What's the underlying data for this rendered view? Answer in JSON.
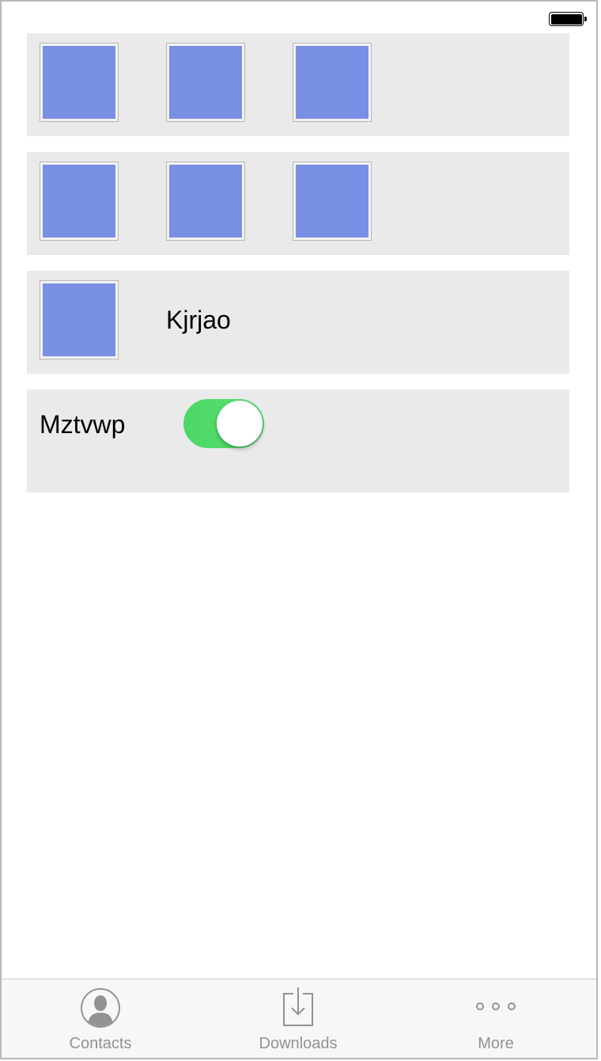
{
  "status_bar": {
    "battery_icon": "battery-full-icon"
  },
  "rows": [
    {
      "type": "tiles",
      "tiles": [
        "image-placeholder",
        "image-placeholder",
        "image-placeholder"
      ]
    },
    {
      "type": "tiles",
      "tiles": [
        "image-placeholder",
        "image-placeholder",
        "image-placeholder"
      ]
    },
    {
      "type": "tile-with-label",
      "label": "Kjrjao"
    },
    {
      "type": "switch",
      "label": "Mztvwp",
      "switch_on": true
    }
  ],
  "tab_bar": {
    "tabs": [
      {
        "label": "Contacts",
        "icon": "contacts-icon"
      },
      {
        "label": "Downloads",
        "icon": "downloads-icon"
      },
      {
        "label": "More",
        "icon": "more-icon"
      }
    ]
  },
  "colors": {
    "tile_fill": "#788fe3",
    "row_background": "#eaeaea",
    "switch_on": "#4cd964",
    "tab_inactive": "#929292"
  }
}
